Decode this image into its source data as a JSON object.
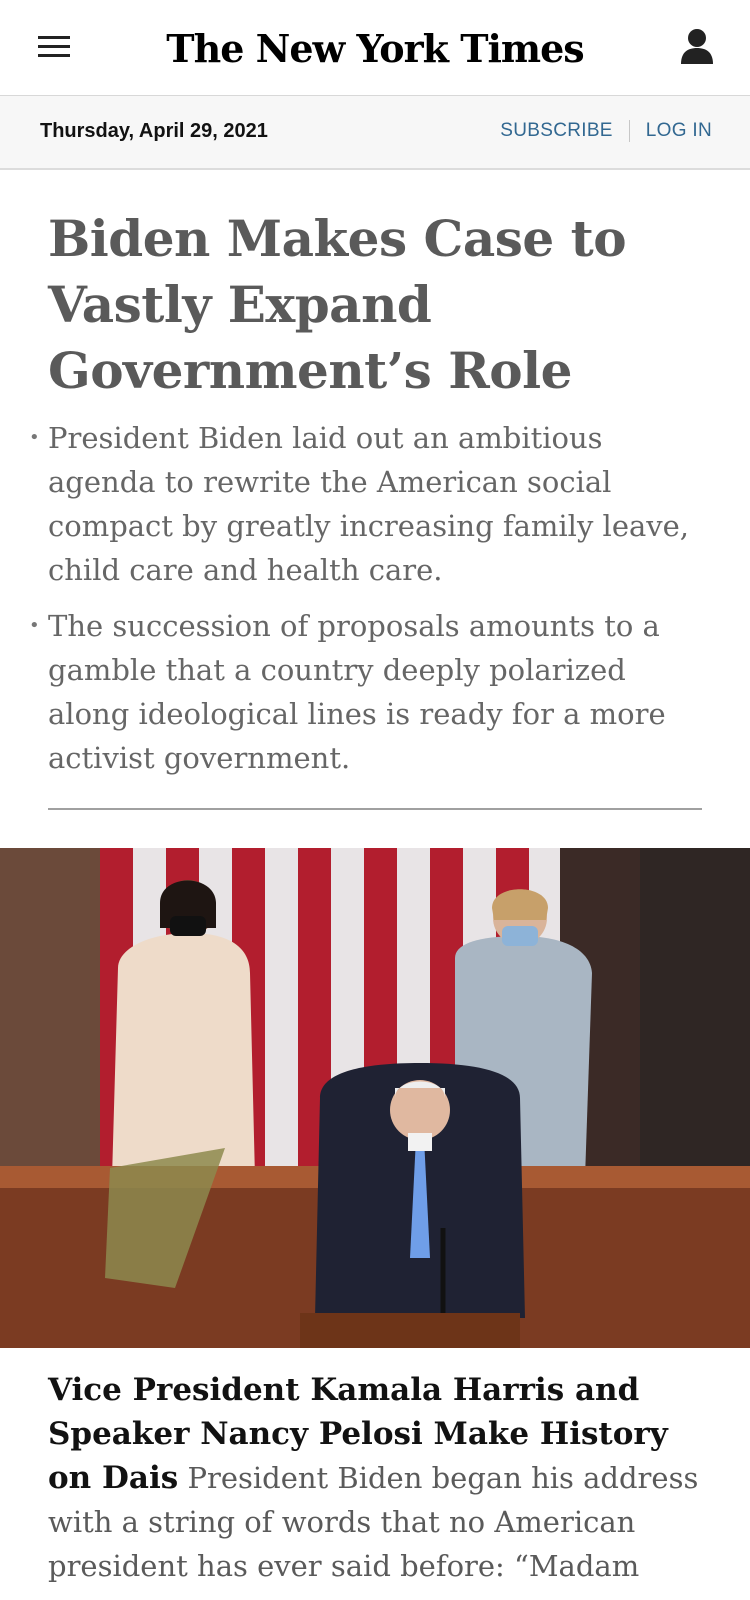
{
  "header": {
    "logo_text": "The New York Times",
    "menu_icon": "hamburger-menu-icon",
    "account_icon": "user-account-icon"
  },
  "datebar": {
    "date": "Thursday, April 29, 2021",
    "subscribe_label": "SUBSCRIBE",
    "login_label": "LOG IN"
  },
  "lead_story": {
    "headline": "Biden Makes Case to Vastly Expand Government’s Role",
    "bullets": [
      "President Biden laid out an ambitious agenda to rewrite the American social compact by greatly increasing family leave, child care and health care.",
      "The succession of proposals amounts to a gamble that a country deeply polarized along ideological lines is ready for a more activist government."
    ]
  },
  "second_story": {
    "headline": "Vice President Kamala Harris and Speaker Nancy Pelosi Make History on Dais",
    "summary": "President Biden began his address with a string of words that no American president has ever said before: “Madam"
  },
  "colors": {
    "link_blue": "#326891",
    "headline_gray": "#5a5a5a",
    "datebar_bg": "#f7f7f7"
  }
}
